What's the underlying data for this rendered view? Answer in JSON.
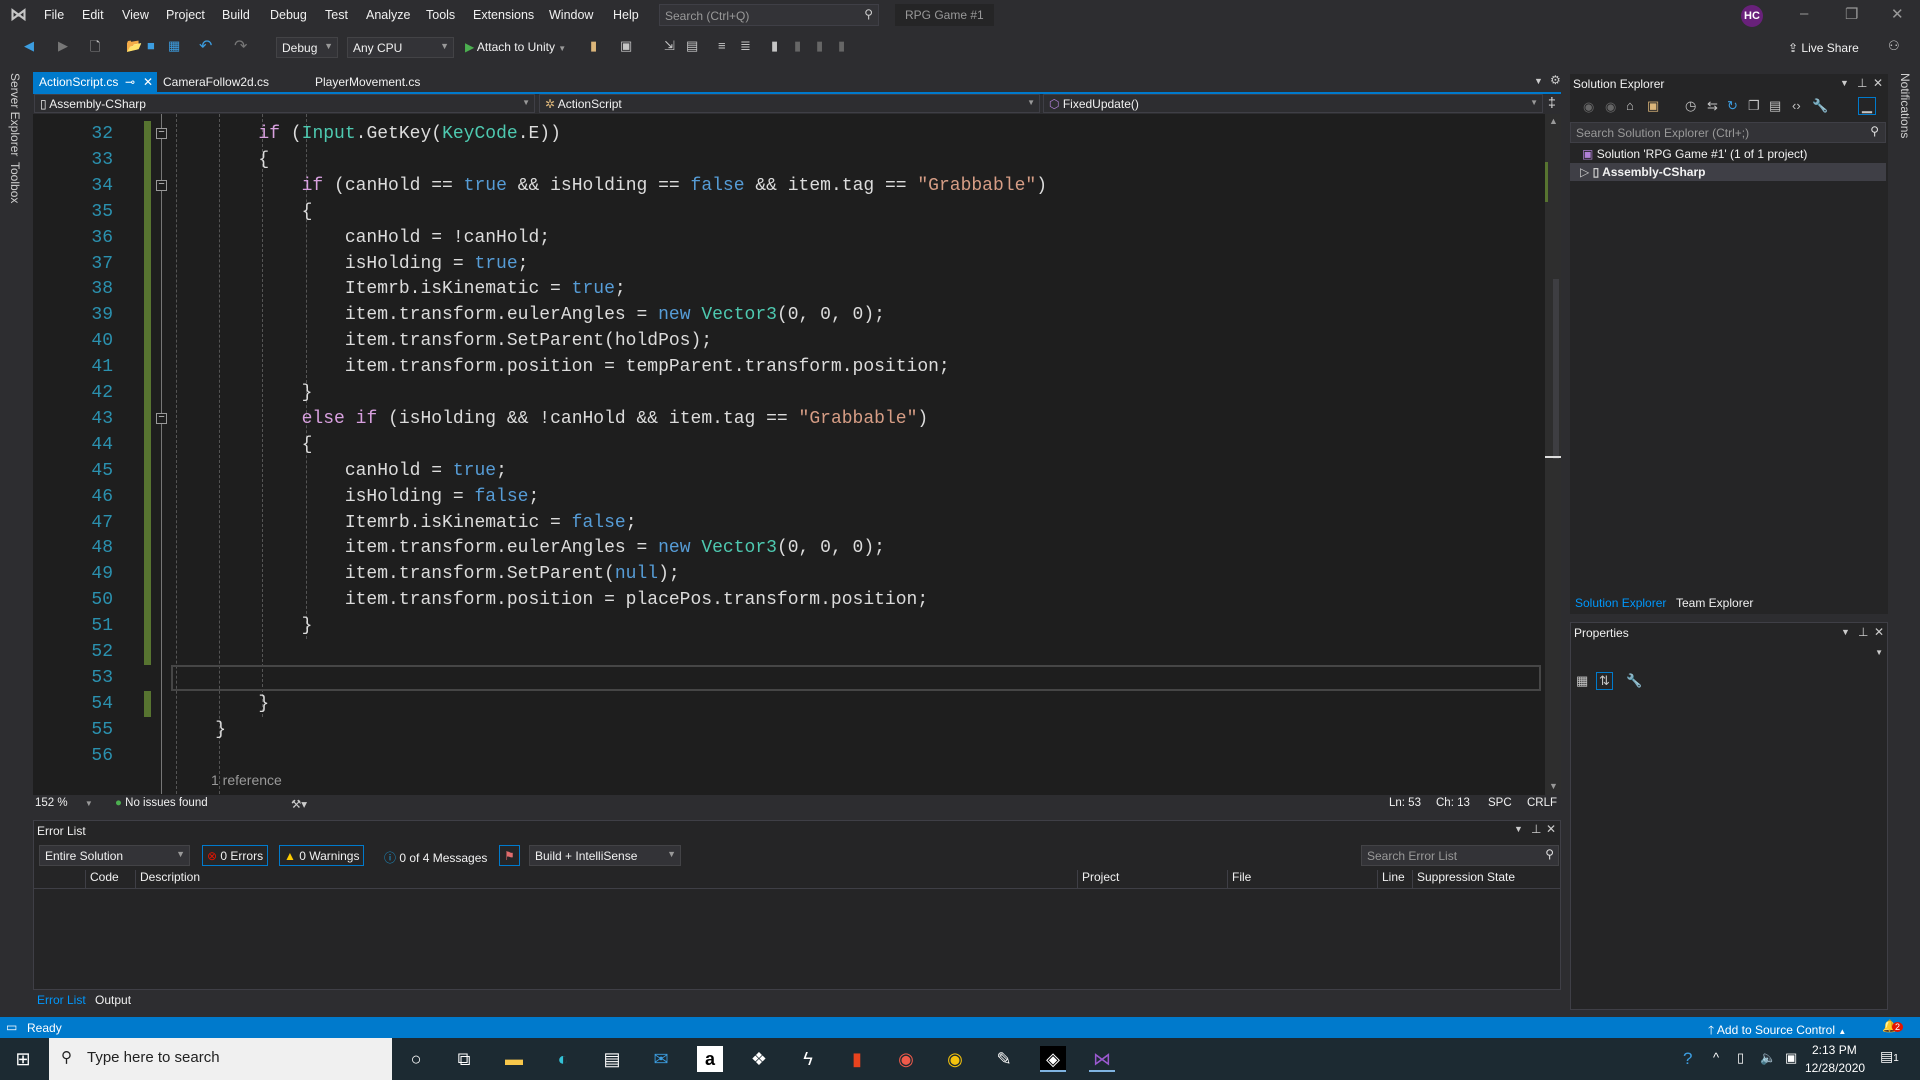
{
  "menubar": {
    "items": [
      "File",
      "Edit",
      "View",
      "Project",
      "Build",
      "Debug",
      "Test",
      "Analyze",
      "Tools",
      "Extensions",
      "Window",
      "Help"
    ],
    "search_placeholder": "Search (Ctrl+Q)",
    "solution_name": "RPG Game #1",
    "user_initials": "HC"
  },
  "toolbar": {
    "config": "Debug",
    "platform": "Any CPU",
    "attach": "Attach to Unity",
    "live_share": "Live Share"
  },
  "sidebar_left": {
    "server_explorer": "Server Explorer",
    "toolbox": "Toolbox"
  },
  "notifications_label": "Notifications",
  "tabs": [
    {
      "label": "ActionScript.cs",
      "active": true
    },
    {
      "label": "CameraFollow2d.cs",
      "active": false
    },
    {
      "label": "PlayerMovement.cs",
      "active": false
    }
  ],
  "navbar": {
    "project": "Assembly-CSharp",
    "class": "ActionScript",
    "member": "FixedUpdate()"
  },
  "editor": {
    "lines": [
      {
        "n": "32",
        "chg": true,
        "fold": true,
        "t": [
          [
            "p",
            "        "
          ],
          [
            "c",
            "if"
          ],
          [
            "p",
            " ("
          ],
          [
            "t",
            "Input"
          ],
          [
            "p",
            ".GetKey("
          ],
          [
            "t",
            "KeyCode"
          ],
          [
            "p",
            ".E))"
          ]
        ]
      },
      {
        "n": "33",
        "chg": true,
        "t": [
          [
            "p",
            "        {"
          ]
        ]
      },
      {
        "n": "34",
        "chg": true,
        "fold": true,
        "t": [
          [
            "p",
            "            "
          ],
          [
            "c",
            "if"
          ],
          [
            "p",
            " (canHold == "
          ],
          [
            "k",
            "true"
          ],
          [
            "p",
            " && isHolding == "
          ],
          [
            "k",
            "false"
          ],
          [
            "p",
            " && item.tag == "
          ],
          [
            "s",
            "\"Grabbable\""
          ],
          [
            "p",
            ")"
          ]
        ]
      },
      {
        "n": "35",
        "chg": true,
        "t": [
          [
            "p",
            "            {"
          ]
        ]
      },
      {
        "n": "36",
        "chg": true,
        "t": [
          [
            "p",
            "                canHold = !canHold;"
          ]
        ]
      },
      {
        "n": "37",
        "chg": true,
        "t": [
          [
            "p",
            "                isHolding = "
          ],
          [
            "k",
            "true"
          ],
          [
            "p",
            ";"
          ]
        ]
      },
      {
        "n": "38",
        "chg": true,
        "t": [
          [
            "p",
            "                Itemrb.isKinematic = "
          ],
          [
            "k",
            "true"
          ],
          [
            "p",
            ";"
          ]
        ]
      },
      {
        "n": "39",
        "chg": true,
        "t": [
          [
            "p",
            "                item.transform.eulerAngles = "
          ],
          [
            "k",
            "new"
          ],
          [
            "p",
            " "
          ],
          [
            "t",
            "Vector3"
          ],
          [
            "p",
            "(0, 0, 0);"
          ]
        ]
      },
      {
        "n": "40",
        "chg": true,
        "t": [
          [
            "p",
            "                item.transform.SetParent(holdPos);"
          ]
        ]
      },
      {
        "n": "41",
        "chg": true,
        "t": [
          [
            "p",
            "                item.transform.position = tempParent.transform.position;"
          ]
        ]
      },
      {
        "n": "42",
        "chg": true,
        "t": [
          [
            "p",
            "            }"
          ]
        ]
      },
      {
        "n": "43",
        "chg": true,
        "fold": true,
        "t": [
          [
            "p",
            "            "
          ],
          [
            "c",
            "else"
          ],
          [
            "p",
            " "
          ],
          [
            "c",
            "if"
          ],
          [
            "p",
            " (isHolding && !canHold && item.tag == "
          ],
          [
            "s",
            "\"Grabbable\""
          ],
          [
            "p",
            ")"
          ]
        ]
      },
      {
        "n": "44",
        "chg": true,
        "t": [
          [
            "p",
            "            {"
          ]
        ]
      },
      {
        "n": "45",
        "chg": true,
        "t": [
          [
            "p",
            "                canHold = "
          ],
          [
            "k",
            "true"
          ],
          [
            "p",
            ";"
          ]
        ]
      },
      {
        "n": "46",
        "chg": true,
        "t": [
          [
            "p",
            "                isHolding = "
          ],
          [
            "k",
            "false"
          ],
          [
            "p",
            ";"
          ]
        ]
      },
      {
        "n": "47",
        "chg": true,
        "t": [
          [
            "p",
            "                Itemrb.isKinematic = "
          ],
          [
            "k",
            "false"
          ],
          [
            "p",
            ";"
          ]
        ]
      },
      {
        "n": "48",
        "chg": true,
        "t": [
          [
            "p",
            "                item.transform.eulerAngles = "
          ],
          [
            "k",
            "new"
          ],
          [
            "p",
            " "
          ],
          [
            "t",
            "Vector3"
          ],
          [
            "p",
            "(0, 0, 0);"
          ]
        ]
      },
      {
        "n": "49",
        "chg": true,
        "t": [
          [
            "p",
            "                item.transform.SetParent("
          ],
          [
            "k",
            "null"
          ],
          [
            "p",
            ");"
          ]
        ]
      },
      {
        "n": "50",
        "chg": true,
        "t": [
          [
            "p",
            "                item.transform.position = placePos.transform.position;"
          ]
        ]
      },
      {
        "n": "51",
        "chg": true,
        "t": [
          [
            "p",
            "            }"
          ]
        ]
      },
      {
        "n": "52",
        "chg": true,
        "t": []
      },
      {
        "n": "53",
        "current": true,
        "t": []
      },
      {
        "n": "54",
        "chg": true,
        "t": [
          [
            "p",
            "        }"
          ]
        ]
      },
      {
        "n": "55",
        "t": [
          [
            "p",
            "    }"
          ]
        ]
      },
      {
        "n": "56",
        "t": []
      }
    ],
    "codelens": "1 reference"
  },
  "editor_status": {
    "zoom": "152 %",
    "issues": "No issues found",
    "line": "Ln: 53",
    "col": "Ch: 13",
    "whitespace": "SPC",
    "eol": "CRLF"
  },
  "error_list": {
    "title": "Error List",
    "scope": "Entire Solution",
    "errors": "0 Errors",
    "warnings": "0 Warnings",
    "messages": "0 of 4 Messages",
    "source": "Build + IntelliSense",
    "search_placeholder": "Search Error List",
    "columns": [
      "Code",
      "Description",
      "Project",
      "File",
      "Line",
      "Suppression State"
    ]
  },
  "bottom_tabs": [
    "Error List",
    "Output"
  ],
  "statusbar": {
    "ready": "Ready",
    "source_control": "Add to Source Control",
    "notification_count": "2"
  },
  "solution_explorer": {
    "title": "Solution Explorer",
    "search_placeholder": "Search Solution Explorer (Ctrl+;)",
    "tree": [
      "Solution 'RPG Game #1' (1 of 1 project)",
      "Assembly-CSharp"
    ],
    "tabs": [
      "Solution Explorer",
      "Team Explorer"
    ]
  },
  "properties": {
    "title": "Properties"
  },
  "taskbar": {
    "search_placeholder": "Type here to search",
    "time": "2:13 PM",
    "date": "12/28/2020",
    "action_center_count": "1"
  },
  "colors": {
    "accent": "#007acc",
    "change_bar": "#577430",
    "keyword": "#569cd6",
    "control_keyword": "#d8a0df",
    "type": "#4ec9b0",
    "string": "#d69d85",
    "line_number": "#2b91af"
  }
}
